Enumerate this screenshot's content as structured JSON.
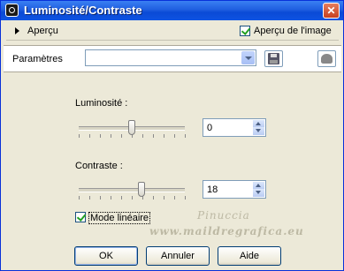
{
  "window": {
    "title": "Luminosité/Contraste",
    "close_glyph": "✕"
  },
  "preview": {
    "label": "Aperçu",
    "image_label": "Aperçu de l'image",
    "image_checked": true
  },
  "params": {
    "label": "Paramètres",
    "value": ""
  },
  "brightness": {
    "label": "Luminosité :",
    "value": "0",
    "slider_fraction": 0.5
  },
  "contrast": {
    "label": "Contraste :",
    "value": "18",
    "slider_fraction": 0.59
  },
  "linear_mode": {
    "label": "Mode linéaire",
    "checked": true
  },
  "watermark": {
    "line1": "Pinuccia",
    "line2": "www.maildregrafica.eu"
  },
  "buttons": {
    "ok": "OK",
    "cancel": "Annuler",
    "help": "Aide"
  },
  "colors": {
    "title_bar": "#0a4ad6",
    "dialog_bg": "#ece9d8",
    "checkmark": "#21a121"
  }
}
